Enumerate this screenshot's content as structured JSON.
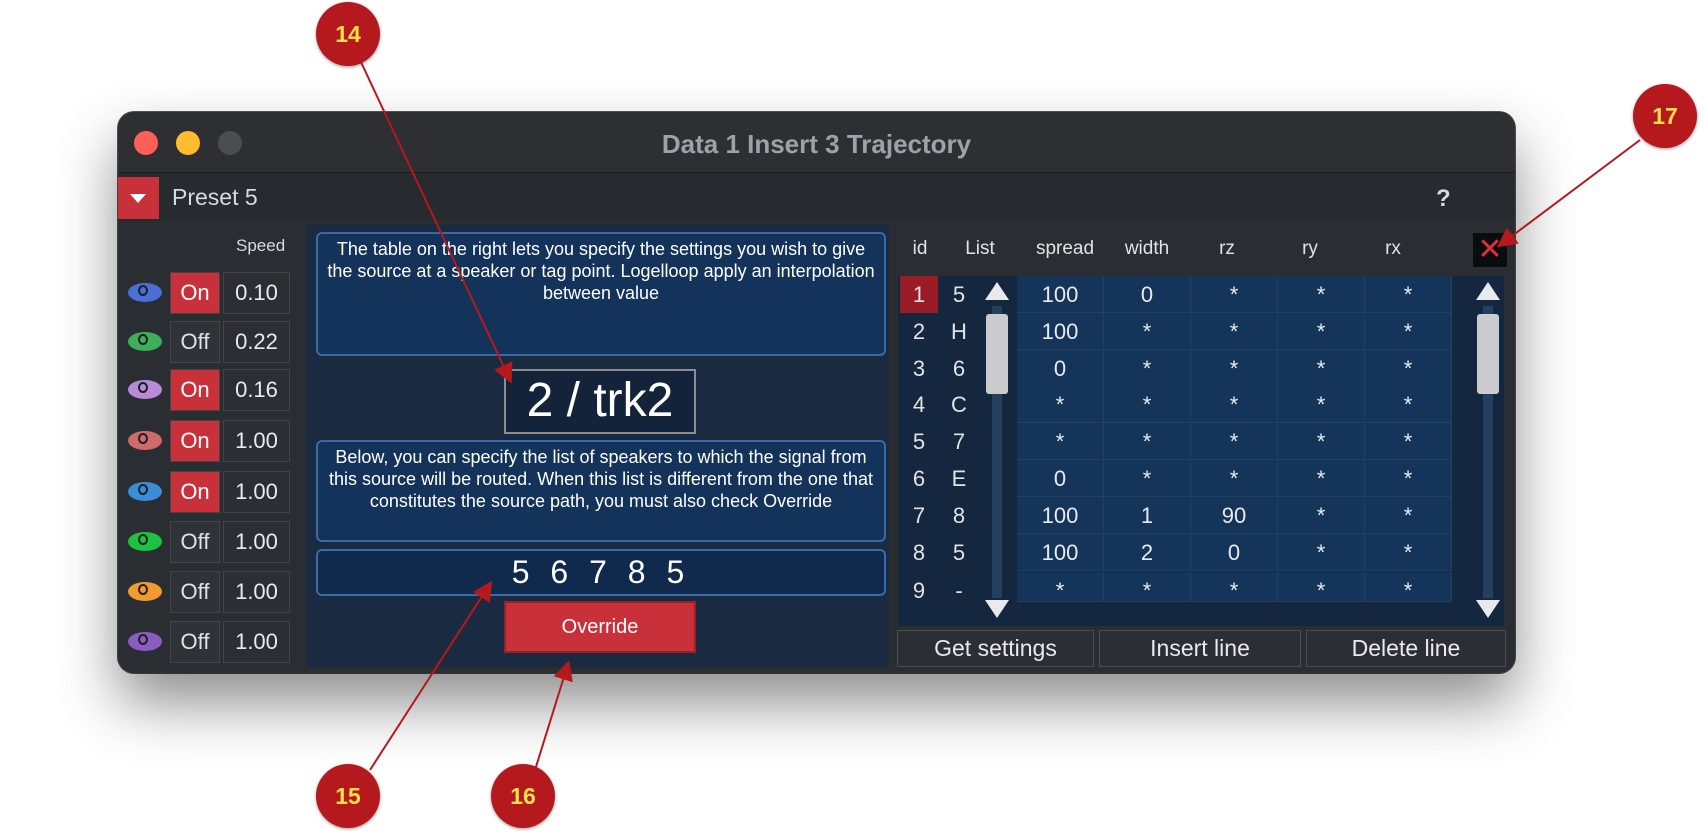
{
  "window": {
    "title": "Data 1 Insert 3 Trajectory"
  },
  "preset": {
    "label": "Preset 5",
    "help": "?"
  },
  "sources": {
    "speed_header": "Speed",
    "rows": [
      {
        "eye_color": "#4a6fd6",
        "state": "On",
        "speed": "0.10"
      },
      {
        "eye_color": "#3fae5a",
        "state": "Off",
        "speed": "0.22"
      },
      {
        "eye_color": "#b98ad9",
        "state": "On",
        "speed": "0.16"
      },
      {
        "eye_color": "#d06a6a",
        "state": "On",
        "speed": "1.00"
      },
      {
        "eye_color": "#3a8ed8",
        "state": "On",
        "speed": "1.00"
      },
      {
        "eye_color": "#1fc23e",
        "state": "Off",
        "speed": "1.00"
      },
      {
        "eye_color": "#f29a2e",
        "state": "Off",
        "speed": "1.00"
      },
      {
        "eye_color": "#8a5cc0",
        "state": "Off",
        "speed": "1.00"
      }
    ]
  },
  "middle": {
    "info_text": "The table on the right lets you specify the settings you wish to give the source at a speaker or tag point. Logelloop apply an interpolation between value",
    "track_display": "2 / trk2",
    "route_text": "Below, you can specify the list of speakers to which the signal from this source will be routed. When this list is different from the one that constitutes the source path, you must also check Override",
    "speaker_list": "5 6 7 8 5",
    "override_label": "Override"
  },
  "table": {
    "headers": [
      "id",
      "List",
      "spread",
      "width",
      "rz",
      "ry",
      "rx"
    ],
    "rows": [
      {
        "id": "1",
        "list": "5",
        "spread": "100",
        "width": "0",
        "rz": "*",
        "ry": "*",
        "rx": "*"
      },
      {
        "id": "2",
        "list": "H",
        "spread": "100",
        "width": "*",
        "rz": "*",
        "ry": "*",
        "rx": "*"
      },
      {
        "id": "3",
        "list": "6",
        "spread": "0",
        "width": "*",
        "rz": "*",
        "ry": "*",
        "rx": "*"
      },
      {
        "id": "4",
        "list": "C",
        "spread": "*",
        "width": "*",
        "rz": "*",
        "ry": "*",
        "rx": "*"
      },
      {
        "id": "5",
        "list": "7",
        "spread": "*",
        "width": "*",
        "rz": "*",
        "ry": "*",
        "rx": "*"
      },
      {
        "id": "6",
        "list": "E",
        "spread": "0",
        "width": "*",
        "rz": "*",
        "ry": "*",
        "rx": "*"
      },
      {
        "id": "7",
        "list": "8",
        "spread": "100",
        "width": "1",
        "rz": "90",
        "ry": "*",
        "rx": "*"
      },
      {
        "id": "8",
        "list": "5",
        "spread": "100",
        "width": "2",
        "rz": "0",
        "ry": "*",
        "rx": "*"
      },
      {
        "id": "9",
        "list": "-",
        "spread": "*",
        "width": "*",
        "rz": "*",
        "ry": "*",
        "rx": "*"
      }
    ],
    "selected_row": "1",
    "close_glyph": "✕",
    "buttons": {
      "get_settings": "Get settings",
      "insert_line": "Insert line",
      "delete_line": "Delete line"
    }
  },
  "callouts": [
    "14",
    "15",
    "16",
    "17"
  ]
}
